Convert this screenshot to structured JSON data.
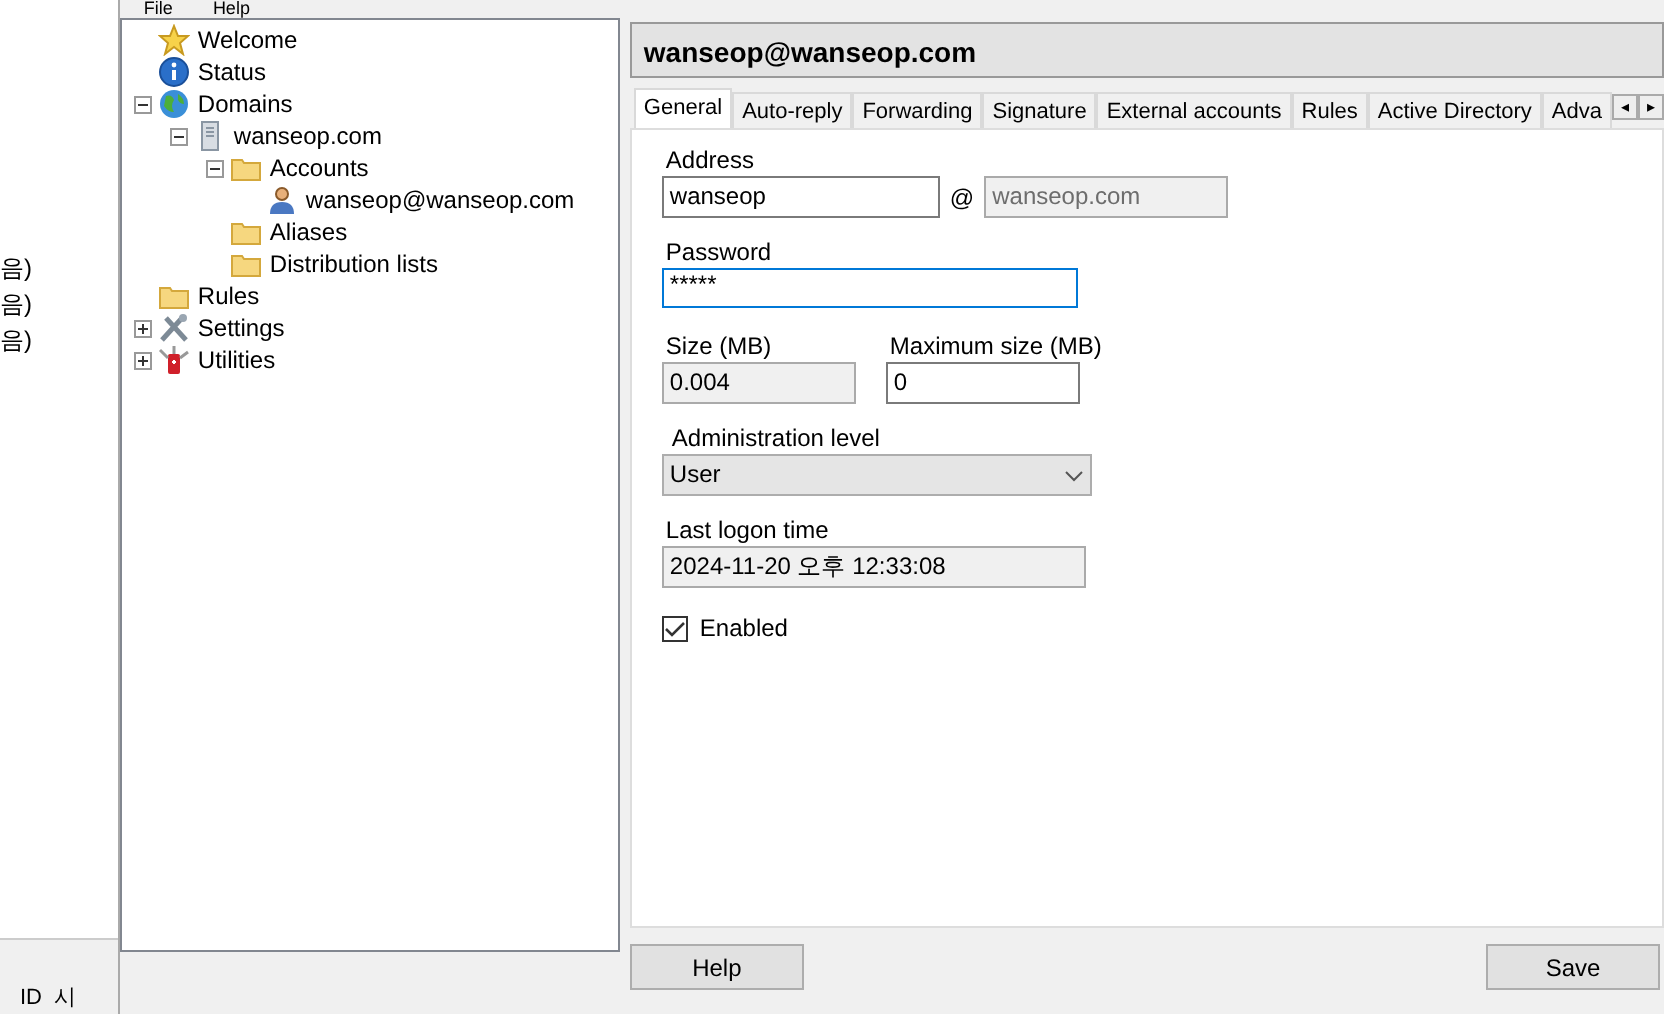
{
  "background_window": {
    "lines": [
      "음)",
      "음)",
      "음)"
    ],
    "bottom_tabs": [
      "ID",
      "시"
    ]
  },
  "menu": [
    "File",
    "Help"
  ],
  "tree": [
    {
      "label": "Welcome",
      "kind": "star"
    },
    {
      "label": "Status",
      "kind": "info"
    },
    {
      "label": "Domains",
      "kind": "globe",
      "expanded": true,
      "children": [
        {
          "label": "wanseop.com",
          "kind": "server",
          "expanded": true,
          "children": [
            {
              "label": "Accounts",
              "kind": "folder",
              "expanded": true,
              "children": [
                {
                  "label": "wanseop@wanseop.com",
                  "kind": "user"
                }
              ]
            },
            {
              "label": "Aliases",
              "kind": "folder"
            },
            {
              "label": "Distribution lists",
              "kind": "folder"
            }
          ]
        }
      ]
    },
    {
      "label": "Rules",
      "kind": "folder"
    },
    {
      "label": "Settings",
      "kind": "tools",
      "expanded": false
    },
    {
      "label": "Utilities",
      "kind": "knife",
      "expanded": false
    }
  ],
  "panel_title": "wanseop@wanseop.com",
  "tabs": [
    {
      "label": "General",
      "selected": true
    },
    {
      "label": "Auto-reply",
      "selected": false
    },
    {
      "label": "Forwarding",
      "selected": false
    },
    {
      "label": "Signature",
      "selected": false
    },
    {
      "label": "External accounts",
      "selected": false
    },
    {
      "label": "Rules",
      "selected": false
    },
    {
      "label": "Active Directory",
      "selected": false
    },
    {
      "label": "Adva",
      "selected": false
    }
  ],
  "tab_scroll": [
    "◂",
    "▸"
  ],
  "form": {
    "address_label": "Address",
    "address": "wanseop",
    "at": "@",
    "domain": "wanseop.com",
    "password_label": "Password",
    "password": "*****",
    "size_label": "Size (MB)",
    "size": "0.004",
    "max_size_label": "Maximum size (MB)",
    "max_size": "0",
    "admin_level_label": "Administration level",
    "admin_level": "User",
    "last_logon_label": "Last logon time",
    "last_logon": "2024-11-20 오후 12:33:08",
    "enabled_label": "Enabled",
    "enabled": true
  },
  "buttons": [
    "Help",
    "Save"
  ]
}
